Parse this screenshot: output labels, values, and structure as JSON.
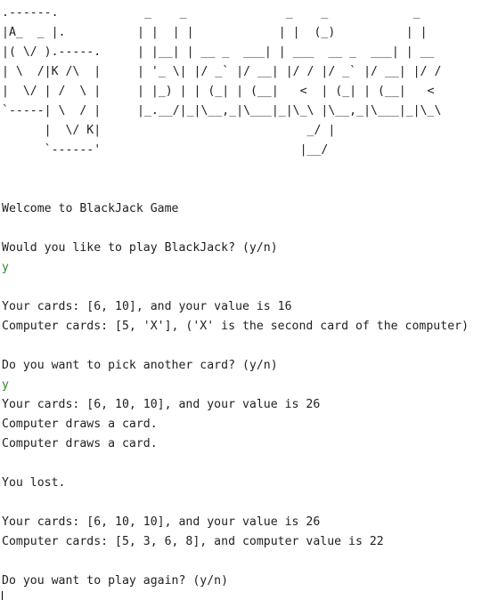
{
  "console": {
    "art_card": ".------.\n|A_  _ |.\n|( \\/ ).-----.\n| \\  /|K /\\  |\n|  \\/ | /  \\ |\n`-----| \\  / |\n      |  \\/ K|\n      `------'",
    "art_title": " _    _              _    _            _\n| |  | |            | |  (_)          | |\n| |__| | __ _  ___| | ___  __ _  ___| | __\n| '_ \\| |/ _` |/ __| |/ / |/ _` |/ __| |/ /\n| |_) | | (_| | (__|   <  | (_| | (__|   <\n|_.__/|_|\\__,_|\\___|_|\\_\\ |\\__,_|\\___|_|\\_\\\n                        _/ |\n                       |__/",
    "welcome": "Welcome to BlackJack Game",
    "prompt_play": "Would you like to play BlackJack? (y/n)",
    "answer_play": "y",
    "your_cards_1": "Your cards: [6, 10], and your value is 16",
    "computer_cards_1": "Computer cards: [5, 'X'], ('X' is the second card of the computer)",
    "prompt_pick": "Do you want to pick another card? (y/n)",
    "answer_pick": "y",
    "your_cards_2": "Your cards: [6, 10, 10], and your value is 26",
    "computer_draws_1": "Computer draws a card.",
    "computer_draws_2": "Computer draws a card.",
    "result": "You lost.",
    "your_cards_final": "Your cards: [6, 10, 10], and your value is 26",
    "computer_cards_final": "Computer cards: [5, 3, 6, 8], and computer value is 22",
    "prompt_again": "Do you want to play again? (y/n)"
  },
  "colors": {
    "background": "#ffffff",
    "text": "#1f1f1f",
    "user_input": "#2e8b2e"
  }
}
